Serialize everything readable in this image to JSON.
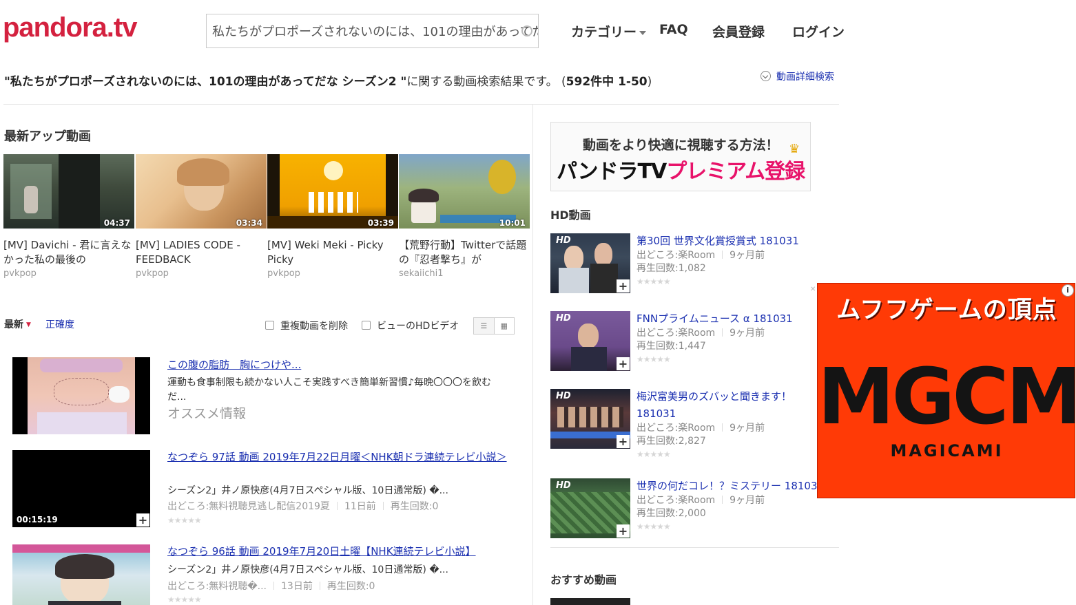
{
  "header": {
    "logo": "pandora.tv",
    "search_value": "私たちがプロポーズされないのには、101の理由があってだな シーズン2",
    "nav": [
      "カテゴリー",
      "FAQ",
      "会員登録",
      "ログイン"
    ]
  },
  "result": {
    "query": "\"私たちがプロポーズされないのには、101の理由があってだな シーズン2 \"",
    "suffix": "に関する動画検索結果です。 (",
    "count": "592件中 1-50",
    "close": ")",
    "advanced": "動画詳細検索"
  },
  "latest": {
    "title": "最新アップ動画",
    "items": [
      {
        "title": "[MV] Davichi - 君に言えなかった私の最後の",
        "channel": "pvkpop",
        "duration": "04:37"
      },
      {
        "title": "[MV] LADIES CODE - FEEDBACK",
        "channel": "pvkpop",
        "duration": "03:34"
      },
      {
        "title": "[MV] Weki Meki - Picky Picky",
        "channel": "pvkpop",
        "duration": "03:39"
      },
      {
        "title": "【荒野行動】Twitterで話題の『忍者撃ち』が",
        "channel": "sekaiichi1",
        "duration": "10:01"
      }
    ]
  },
  "sort": {
    "latest": "最新",
    "accuracy": "正確度",
    "dedupe": "重複動画を削除",
    "hd": "ビューのHDビデオ"
  },
  "results": [
    {
      "title": "この腹の脂肪　胸につけや...",
      "desc": "運動も食事制限も続かない人こそ実践すべき簡単新習慣♪毎晩〇〇〇を飲むだ...",
      "extra": "オススメ情報"
    },
    {
      "title": "なつぞら 97話 動画 2019年7月22日月曜＜NHK朝ドラ連続テレビ小説＞",
      "desc": "シーズン2」井ノ原快彦(4月7日スペシャル版、10日通常版) �...",
      "source": "出どころ:無料視聴見逃し配信2019夏",
      "age": "11日前",
      "views": "再生回数:0",
      "duration": "00:15:19"
    },
    {
      "title": "なつぞら 96話 動画 2019年7月20日土曜【NHK連続テレビ小説】",
      "desc": "シーズン2」井ノ原快彦(4月7日スペシャル版、10日通常版) �...",
      "source": "出どころ:無料視聴�...",
      "age": "13日前",
      "views": "再生回数:0"
    }
  ],
  "banner": {
    "line1": "動画をより快適に視聴する方法！",
    "line2a": "パンドラTV",
    "line2b": "プレミアム登録"
  },
  "hd": {
    "title": "HD動画",
    "badge": "HD",
    "items": [
      {
        "title": "第30回 世界文化賞授賞式 181031",
        "source": "出どころ:楽Room",
        "age": "9ヶ月前",
        "views": "再生回数:1,082"
      },
      {
        "title": "FNNプライムニュース α 181031",
        "source": "出どころ:楽Room",
        "age": "9ヶ月前",
        "views": "再生回数:1,447"
      },
      {
        "title": "梅沢富美男のズバッと聞きます！ 181031",
        "source": "出どころ:楽Room",
        "age": "9ヶ月前",
        "views": "再生回数:2,827"
      },
      {
        "title": "世界の何だコレ！？ミステリー 18103",
        "source": "出どころ:楽Room",
        "age": "9ヶ月前",
        "views": "再生回数:2,000"
      }
    ]
  },
  "recommended": {
    "title": "おすすめ動画"
  },
  "ad": {
    "headline": "ムフフゲームの頂点",
    "logo": "MGCM",
    "sub": "MAGICAMI"
  },
  "colors": {
    "brand": "#d4213f",
    "link": "#1a2fb0",
    "ad_bg": "#ff3a06"
  }
}
